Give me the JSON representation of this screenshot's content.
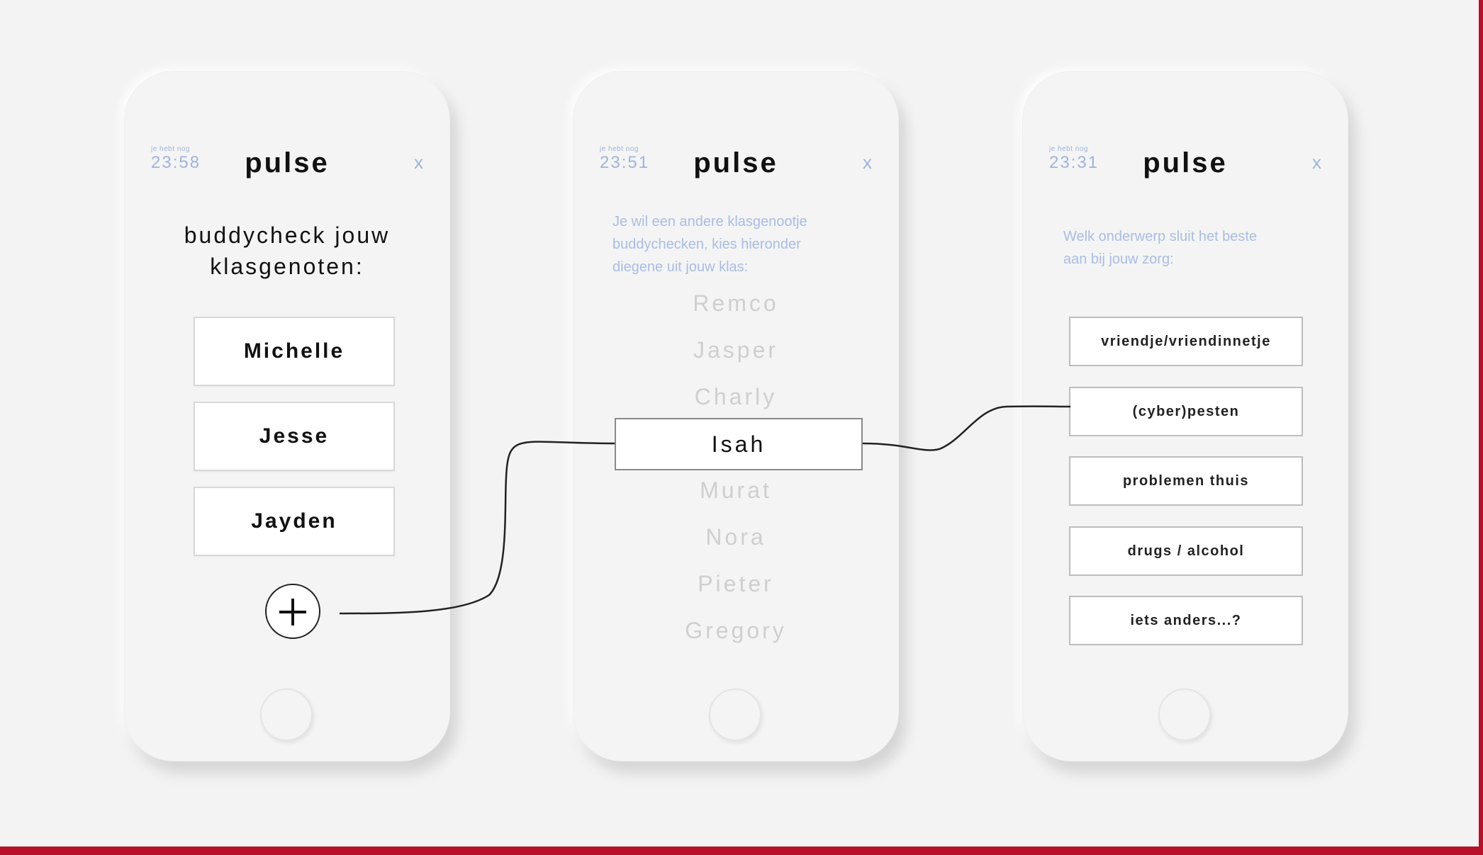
{
  "app": {
    "brand": "pulse"
  },
  "screens": [
    {
      "timer_label": "je hebt nog",
      "timer": "23:58",
      "close": "x",
      "heading_line1": "buddycheck jouw",
      "heading_line2": "klasgenoten:",
      "buddies": [
        "Michelle",
        "Jesse",
        "Jayden"
      ],
      "add_icon": "plus-icon"
    },
    {
      "timer_label": "je hebt nog",
      "timer": "23:51",
      "close": "x",
      "intro_line1": "Je wil een andere klasgenootje",
      "intro_line2": "buddychecken, kies hieronder",
      "intro_line3": "diegene uit jouw klas:",
      "classmates": [
        "Remco",
        "Jasper",
        "Charly",
        "Isah",
        "Murat",
        "Nora",
        "Pieter",
        "Gregory"
      ],
      "selected": "Isah"
    },
    {
      "timer_label": "je hebt nog",
      "timer": "23:31",
      "close": "x",
      "intro_line1": "Welk onderwerp sluit het beste",
      "intro_line2": "aan bij jouw zorg:",
      "topics": [
        "vriendje/vriendinnetje",
        "(cyber)pesten",
        "problemen thuis",
        "drugs / alcohol",
        "iets anders...?"
      ]
    }
  ],
  "colors": {
    "accent": "#b8102a",
    "muted_blue": "#9fb4dd",
    "background": "#f3f3f3"
  }
}
